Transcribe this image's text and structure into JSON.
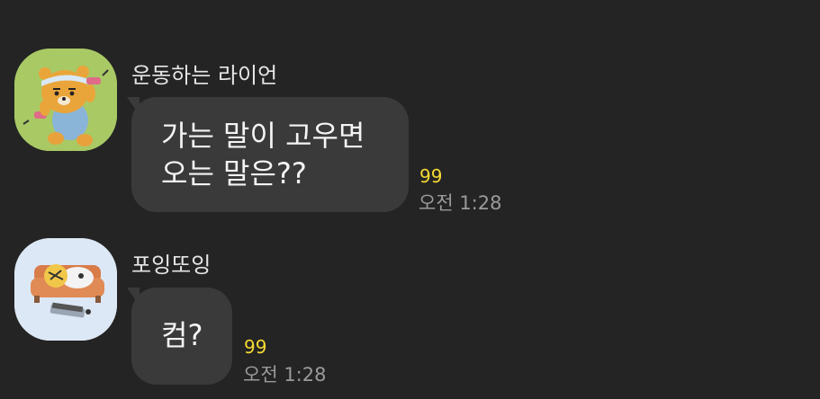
{
  "messages": [
    {
      "sender": "운동하는 라이언",
      "avatar_icon": "ryan-exercising-avatar-icon",
      "lines": [
        "가는 말이 고우면",
        "오는 말은??"
      ],
      "unread": "99",
      "time": "오전 1:28"
    },
    {
      "sender": "포잉또잉",
      "avatar_icon": "sleeping-on-couch-avatar-icon",
      "lines": [
        "컴?"
      ],
      "unread": "99",
      "time": "오전 1:28"
    }
  ],
  "colors": {
    "background": "#242424",
    "bubble": "#3a3a3a",
    "unread": "#f5d833",
    "timestamp": "#9a9a9a"
  }
}
